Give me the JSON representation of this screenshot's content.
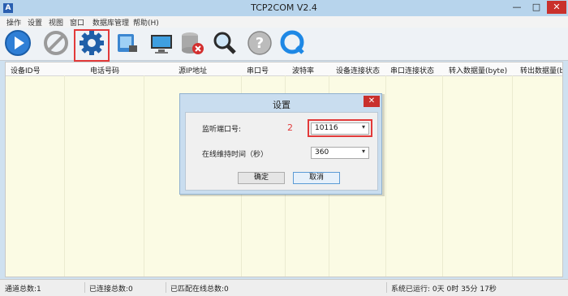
{
  "window": {
    "title": "TCP2COM V2.4",
    "minimize_glyph": "—",
    "maximize_glyph": "□",
    "close_glyph": "✕",
    "app_icon_letter": "A"
  },
  "menu": [
    "操作",
    "设置",
    "视图",
    "窗口",
    "数据库管理",
    "帮助(H)"
  ],
  "toolbar": {
    "icons": [
      "play-icon",
      "stop-icon",
      "gear-icon",
      "tablet-icon",
      "monitor-icon",
      "database-delete-icon",
      "magnifier-icon",
      "help-icon",
      "quicktime-icon"
    ],
    "highlight_label": "1"
  },
  "table": {
    "columns": [
      "设备ID号",
      "电话号码",
      "源IP地址",
      "串口号",
      "波特率",
      "设备连接状态",
      "串口连接状态",
      "转入数据量(byte)",
      "转出数据量(b"
    ],
    "rows": []
  },
  "dialog": {
    "title": "设置",
    "close_glyph": "✕",
    "port_label": "监听端口号:",
    "port_value": "10116",
    "port_highlight_label": "2",
    "keepalive_label": "在线维持时间（秒）",
    "keepalive_value": "360",
    "ok_label": "确定",
    "cancel_label": "取消"
  },
  "status": {
    "total_channels": "通道总数:1",
    "connected": "已连接总数:0",
    "matched_online": "已匹配在线总数:0",
    "uptime": "系统已运行: 0天  0时 35分 17秒"
  },
  "colors": {
    "accent_red": "#e23a3a",
    "grid_background": "#fbfbe4",
    "titlebar": "#b7d4ec"
  }
}
